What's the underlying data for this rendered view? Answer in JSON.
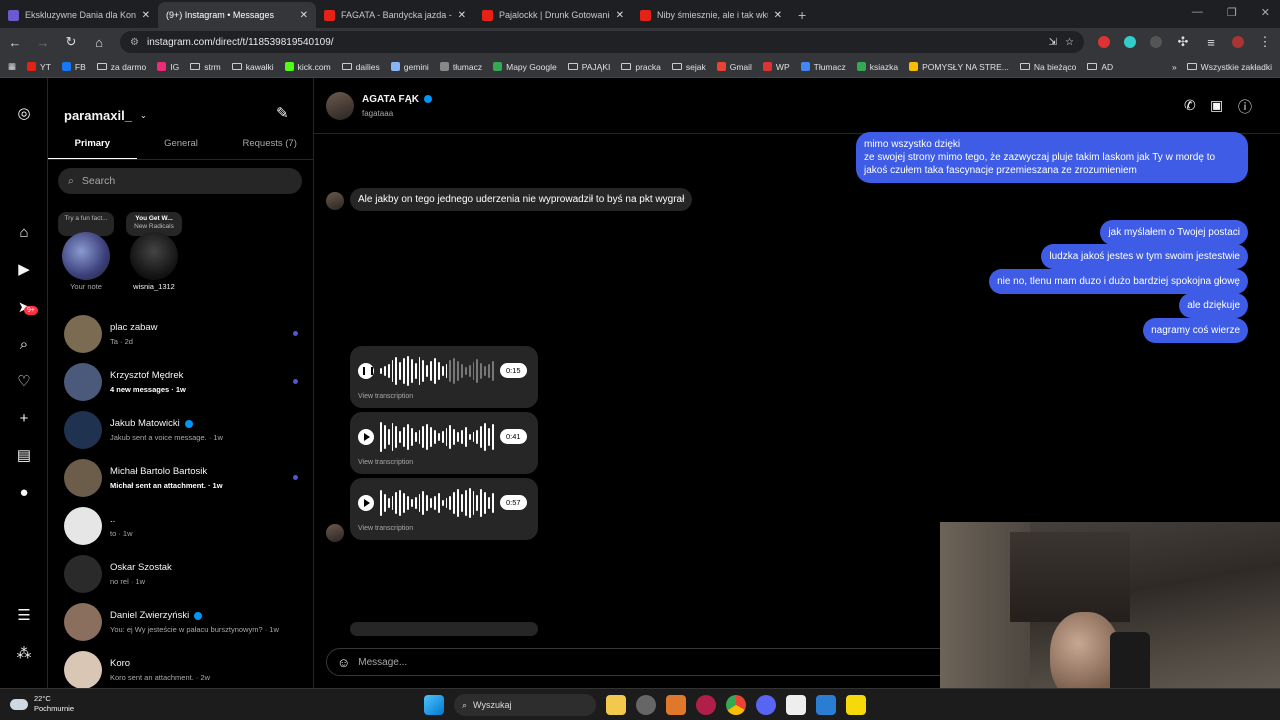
{
  "browser": {
    "tabs": [
      {
        "title": "Ekskluzywne Dania dla Koneser",
        "icon": "generic",
        "active": false
      },
      {
        "title": "(9+) Instagram • Messages",
        "icon": "instagram",
        "active": true
      },
      {
        "title": "FAGATA - Bandycka jazda - You",
        "icon": "youtube",
        "active": false
      },
      {
        "title": "Pajalockk | Drunk Gotowanie z A",
        "icon": "youtube",
        "active": false
      },
      {
        "title": "Niby śmiesznie, ale i tak wkurza",
        "icon": "youtube",
        "active": false
      }
    ],
    "url": "instagram.com/direct/t/118539819540109/",
    "bookmarks": [
      "YT",
      "FB",
      "za darmo",
      "IG",
      "strm",
      "kawałki",
      "kick.com",
      "dailies",
      "gemini",
      "tłumacz",
      "Mapy Google",
      "PAJĄKI",
      "pracka",
      "sejak",
      "Gmail",
      "WP",
      "Tłumacz",
      "ksiazka",
      "POMYSŁY NA STRE...",
      "Na bieżąco",
      "AD"
    ],
    "all_bookmarks": "Wszystkie zakładki"
  },
  "inbox": {
    "username": "paramaxil_",
    "tabs": [
      "Primary",
      "General",
      "Requests (7)"
    ],
    "search_placeholder": "Search",
    "notes": [
      {
        "bubble": "Try a fun fact...",
        "label": "Your note"
      },
      {
        "bubble_title": "You Get W...",
        "bubble_sub": "New Radicals",
        "label": "wisnia_1312"
      }
    ],
    "conversations": [
      {
        "name": "plac zabaw",
        "sub": "Ta · 2d",
        "unread": false,
        "dot": true,
        "verified": false,
        "color": "#7a6b52"
      },
      {
        "name": "Krzysztof Mędrek",
        "sub": "4 new messages · 1w",
        "unread": true,
        "dot": true,
        "verified": false,
        "color": "#4b5a7a"
      },
      {
        "name": "Jakub Matowicki",
        "sub": "Jakub sent a voice message. · 1w",
        "unread": false,
        "dot": false,
        "verified": true,
        "color": "#1f3350"
      },
      {
        "name": "Michał Bartolo Bartosik",
        "sub": "Michał sent an attachment. · 1w",
        "unread": true,
        "dot": true,
        "verified": false,
        "color": "#6b5d4a"
      },
      {
        "name": "..",
        "sub": "to · 1w",
        "unread": false,
        "dot": false,
        "verified": false,
        "color": "#e6e6e6"
      },
      {
        "name": "Oskar Szostak",
        "sub": "no rel · 1w",
        "unread": false,
        "dot": false,
        "verified": false,
        "color": "#2a2a2a"
      },
      {
        "name": "Daniel Zwierzyński",
        "sub": "You: ej Wy jesteście w pałacu bursztynowym? · 1w",
        "unread": false,
        "dot": false,
        "verified": true,
        "color": "#8a6e5e"
      },
      {
        "name": "Koro",
        "sub": "Koro sent an attachment. · 2w",
        "unread": false,
        "dot": false,
        "verified": false,
        "color": "#d9c6b5"
      }
    ]
  },
  "thread": {
    "name": "AGATA FĄK",
    "handle": "fagataaa",
    "messages_out_top": "mimo wszystko dzięki\nze swojej strony mimo tego, że zazwyczaj pluje takim laskom jak Ty w mordę to jakoś czułem taka fascynacje przemieszana ze zrozumieniem",
    "message_in": "Ale jakby on tego jednego uderzenia nie wyprowadził to byś na pkt wygrał",
    "messages_out": [
      "jak myślałem o Twojej postaci",
      "ludzka jakoś jestes w tym swoim jestestwie",
      "nie no, tlenu mam duzo i dużo bardziej spokojna głowę",
      "ale dziękuje",
      "nagramy coś wierze"
    ],
    "voice_messages": [
      {
        "duration": "0:15",
        "transcription": "View transcription",
        "playing": true
      },
      {
        "duration": "0:41",
        "transcription": "View transcription",
        "playing": false
      },
      {
        "duration": "0:57",
        "transcription": "View transcription",
        "playing": false
      }
    ],
    "composer_placeholder": "Message..."
  },
  "taskbar": {
    "temp": "22°C",
    "weather": "Pochmurnie",
    "search": "Wyszukaj"
  },
  "colors": {
    "outgoing": "#3e5ce5",
    "incoming": "#262626",
    "unread_dot": "#5851db",
    "verified": "#0095f6"
  }
}
